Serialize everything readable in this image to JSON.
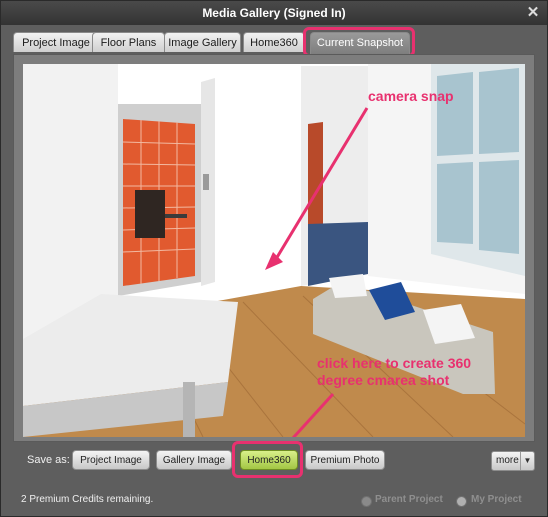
{
  "window": {
    "title": "Media Gallery (Signed In)"
  },
  "tabs": [
    {
      "label": "Project Image"
    },
    {
      "label": "Floor Plans"
    },
    {
      "label": "Image Gallery"
    },
    {
      "label": "Home360"
    },
    {
      "label": "Current Snapshot",
      "active": true
    }
  ],
  "annotations": {
    "camera": "camera snap",
    "hint_line1": "click here to create 360",
    "hint_line2": "degree cmarea shot"
  },
  "savebar": {
    "label": "Save as:",
    "buttons": [
      {
        "label": "Project Image"
      },
      {
        "label": "Gallery Image"
      },
      {
        "label": "Home360",
        "highlighted": true
      },
      {
        "label": "Premium Photo"
      }
    ],
    "more": "more"
  },
  "status": {
    "credits": "2 Premium Credits remaining.",
    "options": [
      {
        "label": "Parent Project"
      },
      {
        "label": "My Project",
        "selected": true
      }
    ]
  },
  "colors": {
    "annotation": "#e8316f",
    "floor": "#c08a4c",
    "tile": "#e15a2f",
    "active_tab": "#8c8c8c",
    "green_button": "#b6d75a"
  },
  "icons": {
    "close": "close-icon",
    "dropdown": "chevron-down-icon"
  }
}
